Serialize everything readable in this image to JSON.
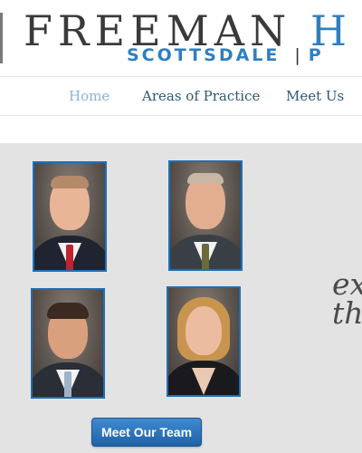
{
  "header": {
    "logo_name_main": "FREEMAN",
    "logo_name_accent": "H",
    "logo_location": "SCOTTSDALE",
    "logo_separator": "|",
    "logo_location_next": "P"
  },
  "nav": {
    "items": [
      {
        "label": "Home",
        "active": true
      },
      {
        "label": "Areas of Practice",
        "active": false
      },
      {
        "label": "Meet Us",
        "active": false
      }
    ]
  },
  "team": {
    "tagline_line1": "ex",
    "tagline_line2": "th",
    "button_label": "Meet Our Team"
  },
  "colors": {
    "brand_blue": "#2f7fc0",
    "nav_text": "#2d5777",
    "nav_active": "#8cb3d6",
    "section_bg": "#e3e3e3",
    "button_blue": "#1f62a6"
  }
}
